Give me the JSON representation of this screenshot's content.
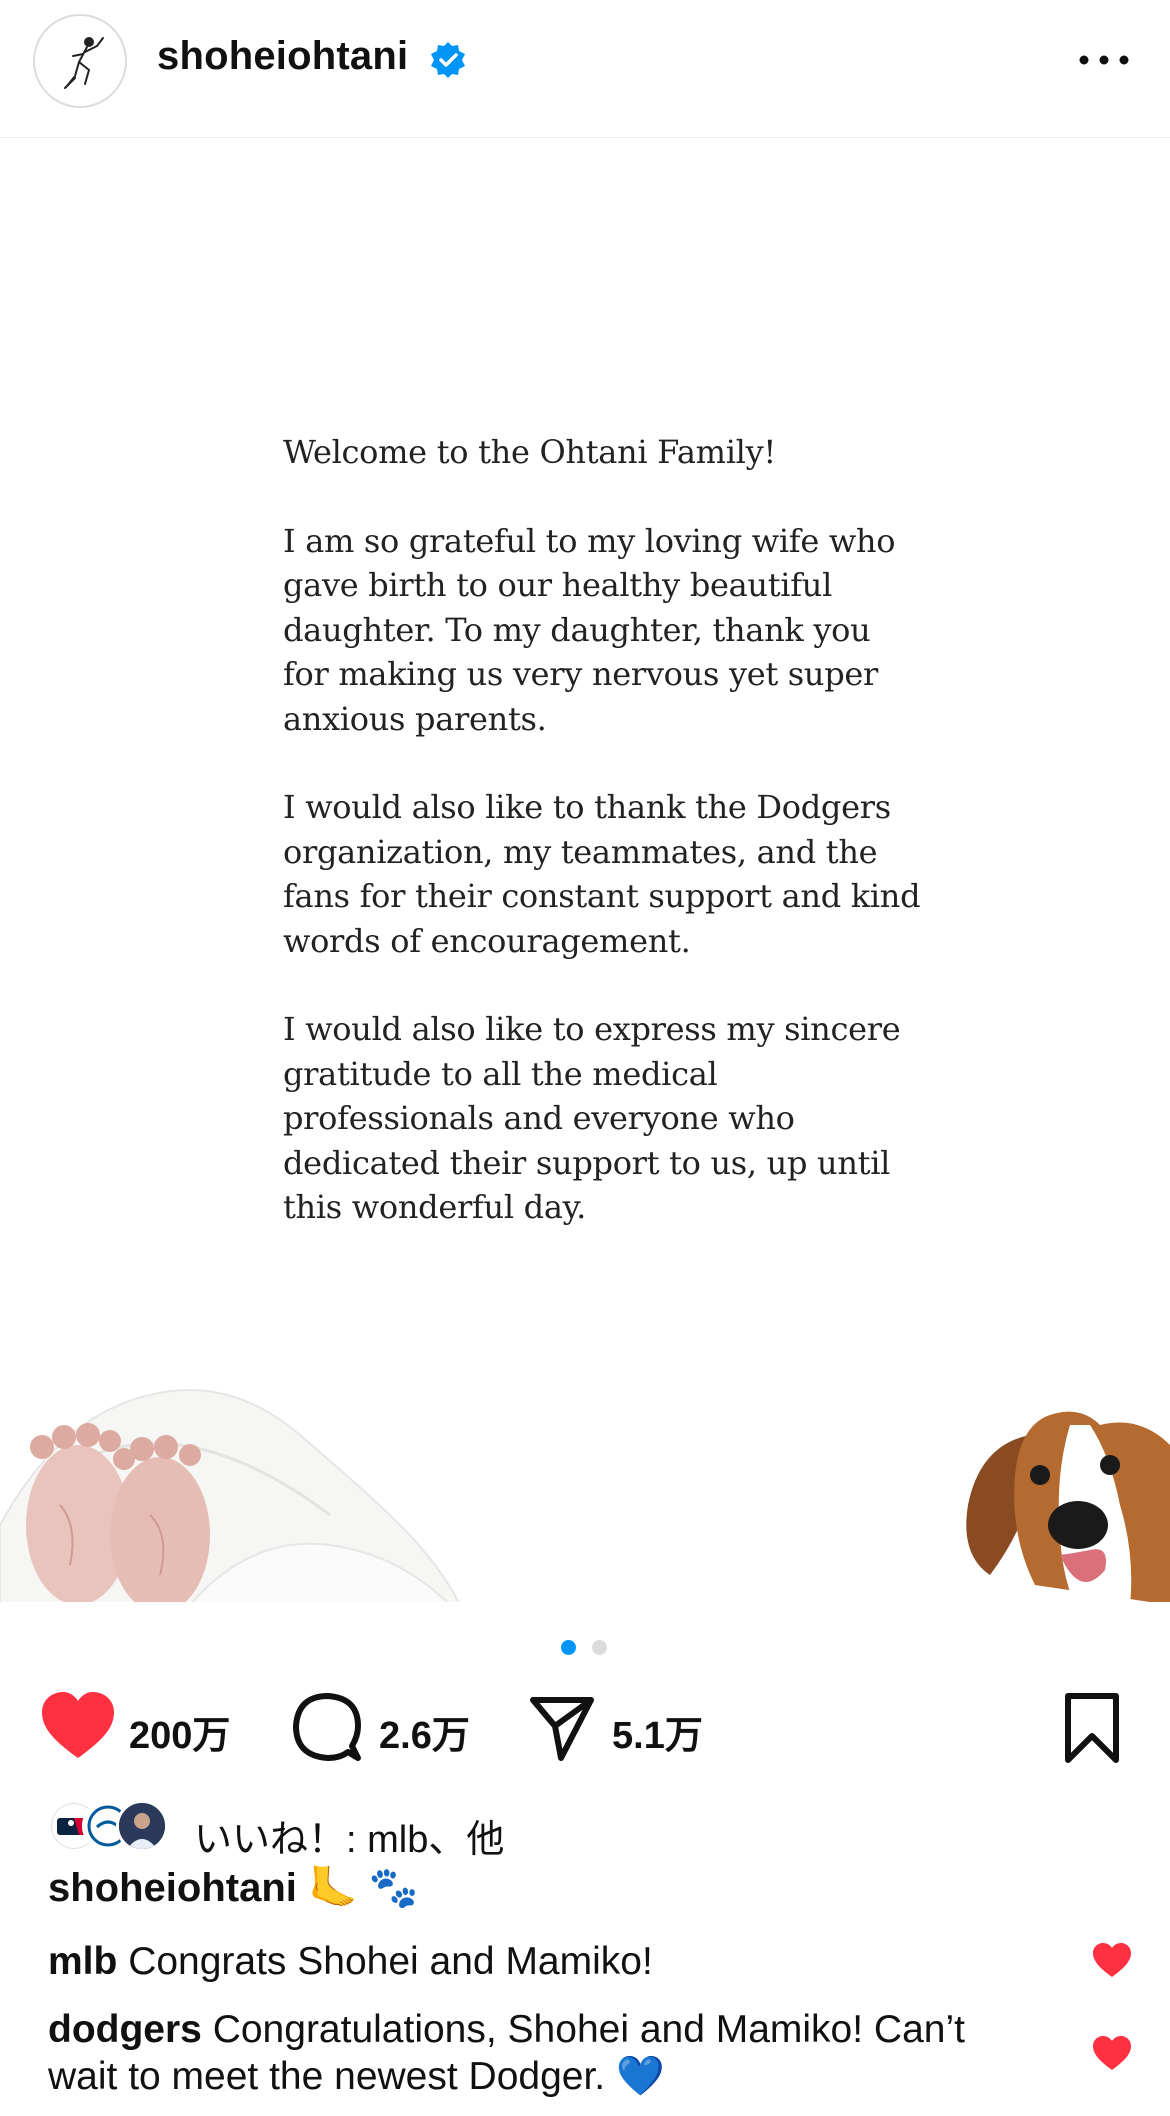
{
  "header": {
    "username": "shoheiohtani",
    "avatar_icon": "baseball-player-sketch-icon",
    "verified_icon": "verified-badge-icon",
    "more_icon": "more-options-icon"
  },
  "post": {
    "letter": {
      "greeting": "Welcome to the Ohtani Family!",
      "paragraph1": "I am so grateful to my loving wife who gave birth to our healthy beautiful daughter. To my daughter, thank you for making us very nervous yet super anxious parents.",
      "paragraph2": "I would also like to thank the Dodgers organization, my teammates, and the fans for their constant support and kind words of encouragement.",
      "paragraph3": "I would also like to express my sincere gratitude to all the medical professionals and everyone who dedicated their support to us, up until this wonderful day."
    },
    "carousel": {
      "current": 1,
      "total": 2
    }
  },
  "actions": {
    "likes": "200万",
    "comments": "2.6万",
    "shares": "5.1万"
  },
  "liked_by": {
    "text": "いいね！: mlb、他"
  },
  "caption": {
    "username": "shoheiohtani",
    "text": "🦶 🐾"
  },
  "comments": [
    {
      "username": "mlb",
      "text": "Congrats Shohei and Mamiko!"
    },
    {
      "username": "dodgers",
      "text": "Congratulations, Shohei and Mamiko! Can’t wait to meet the newest Dodger. 💙"
    }
  ],
  "colors": {
    "like_red": "#ff3040",
    "verified_blue": "#0095f6",
    "dot_active": "#0095f6",
    "dot_inactive": "#dbdbdb",
    "text": "#111111"
  }
}
